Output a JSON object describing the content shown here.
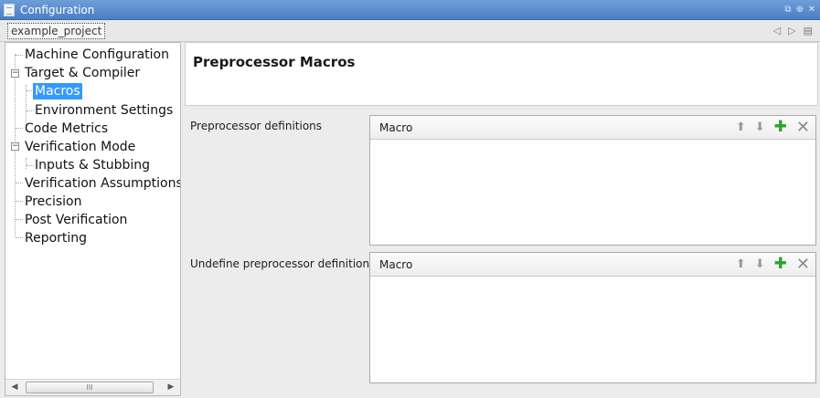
{
  "window": {
    "title": "Configuration",
    "controls": [
      "restore-icon",
      "pin-icon",
      "close-icon"
    ],
    "control_glyphs": [
      "⧉",
      "⊕",
      "✕"
    ]
  },
  "project_bar": {
    "project_name": "example_project",
    "nav_glyphs": [
      "◁",
      "▷",
      "▤"
    ]
  },
  "tree": {
    "items": [
      {
        "label": "Machine Configuration"
      },
      {
        "label": "Target & Compiler"
      },
      {
        "label": "Macros",
        "selected": true
      },
      {
        "label": "Environment Settings"
      },
      {
        "label": "Code Metrics"
      },
      {
        "label": "Verification Mode"
      },
      {
        "label": "Inputs & Stubbing"
      },
      {
        "label": "Verification Assumptions"
      },
      {
        "label": "Precision"
      },
      {
        "label": "Post Verification"
      },
      {
        "label": "Reporting"
      }
    ],
    "scroll_thumb_glyph": "III",
    "expand_glyph": "−"
  },
  "main": {
    "heading": "Preprocessor Macros",
    "sections": [
      {
        "label": "Preprocessor definitions",
        "column": "Macro"
      },
      {
        "label": "Undefine preprocessor definitions",
        "column": "Macro"
      }
    ],
    "tool_glyphs": {
      "up": "⬆",
      "down": "⬇",
      "add": "✚",
      "remove": "✕"
    }
  },
  "colors": {
    "title_bar": "#4a7fc4",
    "selection": "#3399ff",
    "add_icon": "#2fa12f"
  }
}
